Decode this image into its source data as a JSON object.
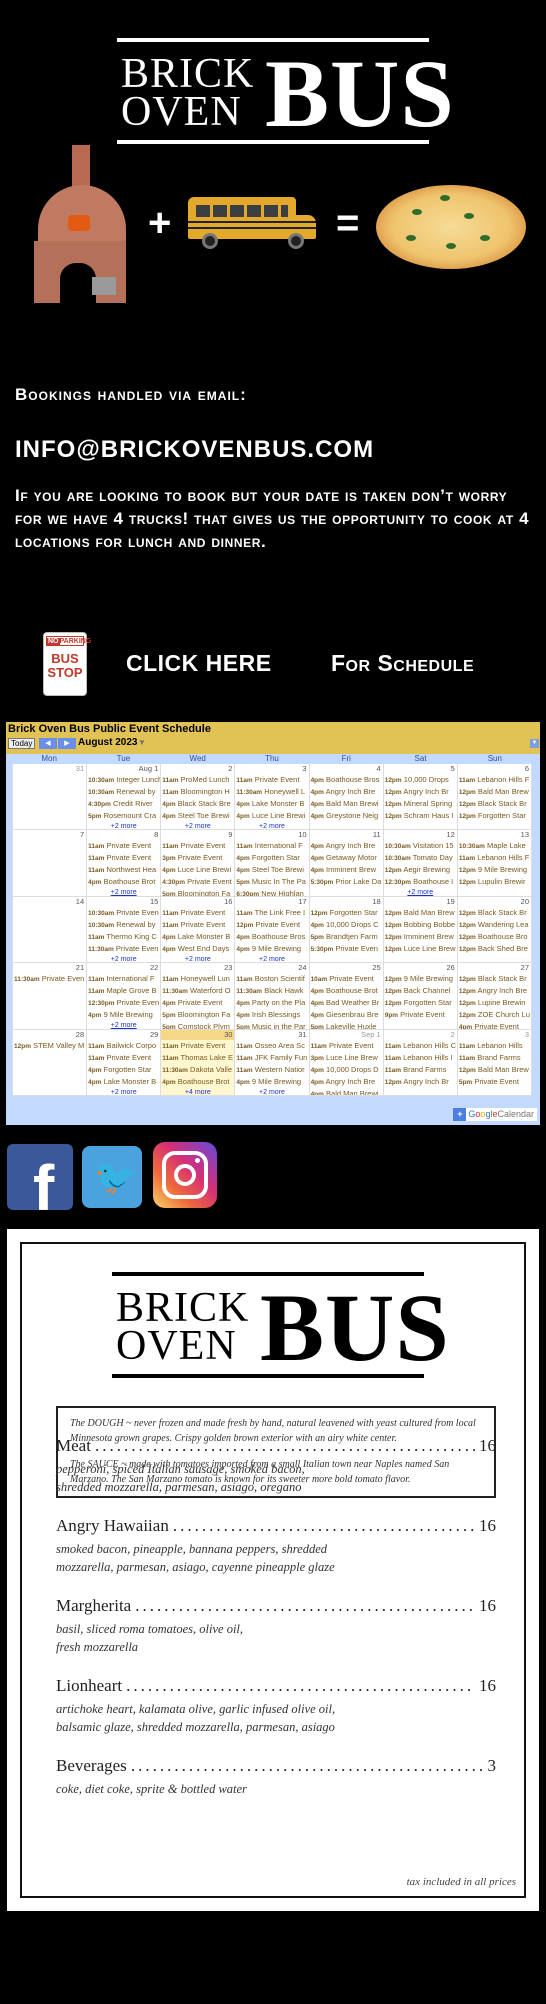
{
  "brand": {
    "logo_line1": "BRICK",
    "logo_line2": "OVEN",
    "logo_big": "BUS",
    "plus": "+",
    "equals": "="
  },
  "contact": {
    "bookings_heading": "Bookings handled via email:",
    "email": "INFO@BRICKOVENBUS.COM",
    "info_text": "If you are looking to book but your date is taken don’t worry for we have  4 trucks! that gives us the opportunity to cook at 4 locations for lunch and dinner."
  },
  "schedule_link": {
    "sign_top": "PARKING",
    "sign_no": "NO",
    "sign_line1": "BUS",
    "sign_line2": "STOP",
    "click_here": "CLICK HERE",
    "for_schedule": "For Schedule"
  },
  "calendar": {
    "title": "Brick Oven Bus Public Event Schedule",
    "today_label": "Today",
    "prev_icon": "◀",
    "next_icon": "▶",
    "month_label": "August 2023",
    "caret": "▼",
    "menu_icon": "▼",
    "days_of_week": [
      "Mon",
      "Tue",
      "Wed",
      "Thu",
      "Fri",
      "Sat",
      "Sun"
    ],
    "footer_plus": "+",
    "footer_google": [
      "G",
      "o",
      "o",
      "g",
      "l",
      "e"
    ],
    "footer_calendar": "Calendar",
    "weeks": [
      [
        {
          "date": "31",
          "other": true,
          "events": [],
          "more": ""
        },
        {
          "date": "Aug 1",
          "events": [
            [
              "10:30am",
              "Integer Lunch"
            ],
            [
              "10:30am",
              "Renewal by"
            ],
            [
              "4:30pm",
              "Credit River"
            ],
            [
              "5pm",
              "Rosemount Cra"
            ]
          ],
          "more": "+2 more"
        },
        {
          "date": "2",
          "events": [
            [
              "11am",
              "ProMed Lunch"
            ],
            [
              "11am",
              "Bloomington H"
            ],
            [
              "4pm",
              "Black Stack Bre"
            ],
            [
              "4pm",
              "Steel Toe Brewi"
            ]
          ],
          "more": "+2 more"
        },
        {
          "date": "3",
          "events": [
            [
              "11am",
              "Private Event"
            ],
            [
              "11:30am",
              "Honeywell L"
            ],
            [
              "4pm",
              "Lake Monster B"
            ],
            [
              "4pm",
              "Luce Line Brewi"
            ]
          ],
          "more": "+2 more"
        },
        {
          "date": "4",
          "events": [
            [
              "4pm",
              "Boathouse Bros"
            ],
            [
              "4pm",
              "Angry Inch Bre"
            ],
            [
              "4pm",
              "Bald Man Brewi"
            ],
            [
              "4pm",
              "Greystone Neig"
            ]
          ],
          "more": ""
        },
        {
          "date": "5",
          "events": [
            [
              "12pm",
              "10,000 Drops"
            ],
            [
              "12pm",
              "Angry Inch Br"
            ],
            [
              "12pm",
              "Mineral Spring"
            ],
            [
              "12pm",
              "Schram Haus I"
            ]
          ],
          "more": ""
        },
        {
          "date": "6",
          "events": [
            [
              "11am",
              "Lebanon Hills F"
            ],
            [
              "12pm",
              "Bald Man Brew"
            ],
            [
              "12pm",
              "Black Stack Br"
            ],
            [
              "12pm",
              "Forgotten Star"
            ]
          ],
          "more": ""
        }
      ],
      [
        {
          "date": "7",
          "events": [],
          "more": ""
        },
        {
          "date": "8",
          "events": [
            [
              "11am",
              "Private Event"
            ],
            [
              "11am",
              "Private Event"
            ],
            [
              "11am",
              "Northwest Hea"
            ],
            [
              "4pm",
              "Boathouse Brot"
            ]
          ],
          "more": "+2 more"
        },
        {
          "date": "9",
          "events": [
            [
              "11am",
              "Private Event"
            ],
            [
              "3pm",
              "Private Event"
            ],
            [
              "4pm",
              "Luce Line Brewi"
            ],
            [
              "4:30pm",
              "Private Event"
            ],
            [
              "5pm",
              "Bloomington Fa"
            ]
          ],
          "more": ""
        },
        {
          "date": "10",
          "events": [
            [
              "11am",
              "International F"
            ],
            [
              "4pm",
              "Forgotten Star"
            ],
            [
              "4pm",
              "Steel Toe Brewi"
            ],
            [
              "5pm",
              "Music In The Pa"
            ],
            [
              "6:30pm",
              "New Highlan"
            ]
          ],
          "more": ""
        },
        {
          "date": "11",
          "events": [
            [
              "4pm",
              "Angry Inch Bre"
            ],
            [
              "4pm",
              "Getaway Motor"
            ],
            [
              "4pm",
              "Imminent Brew"
            ],
            [
              "5:30pm",
              "Prior Lake Da"
            ]
          ],
          "more": ""
        },
        {
          "date": "12",
          "events": [
            [
              "10:30am",
              "Visitation 15"
            ],
            [
              "10:30am",
              "Tomato Day"
            ],
            [
              "12pm",
              "Aegir Brewing"
            ],
            [
              "12:30pm",
              "Boathouse I"
            ]
          ],
          "more": "+2 more"
        },
        {
          "date": "13",
          "events": [
            [
              "10:30am",
              "Maple Lake"
            ],
            [
              "11am",
              "Lebanon Hills F"
            ],
            [
              "12pm",
              "9 Mile Brewing"
            ],
            [
              "12pm",
              "Lupulin Brewir"
            ]
          ],
          "more": ""
        }
      ],
      [
        {
          "date": "14",
          "events": [],
          "more": ""
        },
        {
          "date": "15",
          "events": [
            [
              "10:30am",
              "Private Even"
            ],
            [
              "10:30am",
              "Renewal by"
            ],
            [
              "11am",
              "Thermo King C"
            ],
            [
              "11:30am",
              "Private Even"
            ]
          ],
          "more": "+2 more"
        },
        {
          "date": "16",
          "events": [
            [
              "11am",
              "Private Event"
            ],
            [
              "11am",
              "Private Event"
            ],
            [
              "4pm",
              "Lake Monster B"
            ],
            [
              "4pm",
              "West End Days"
            ]
          ],
          "more": "+2 more"
        },
        {
          "date": "17",
          "events": [
            [
              "11am",
              "The Link Free I"
            ],
            [
              "12pm",
              "Private Event"
            ],
            [
              "4pm",
              "Boathouse Bros"
            ],
            [
              "4pm",
              "9 Mile Brewing"
            ]
          ],
          "more": "+2 more"
        },
        {
          "date": "18",
          "events": [
            [
              "12pm",
              "Forgotten Star"
            ],
            [
              "4pm",
              "10,000 Drops C"
            ],
            [
              "5pm",
              "Brandtjen Farm"
            ],
            [
              "5:30pm",
              "Private Even"
            ]
          ],
          "more": ""
        },
        {
          "date": "19",
          "events": [
            [
              "12pm",
              "Bald Man Brew"
            ],
            [
              "12pm",
              "Bobbing Bobbe"
            ],
            [
              "12pm",
              "Imminent Brew"
            ],
            [
              "12pm",
              "Luce Line Brew"
            ]
          ],
          "more": ""
        },
        {
          "date": "20",
          "events": [
            [
              "12pm",
              "Black Stack Br"
            ],
            [
              "12pm",
              "Wandering Lea"
            ],
            [
              "12pm",
              "Boathouse Bro"
            ],
            [
              "12pm",
              "Back Shed Bre"
            ]
          ],
          "more": ""
        }
      ],
      [
        {
          "date": "21",
          "events": [
            [
              "11:30am",
              "Private Even"
            ]
          ],
          "more": ""
        },
        {
          "date": "22",
          "events": [
            [
              "11am",
              "International F"
            ],
            [
              "11am",
              "Maple Grove B"
            ],
            [
              "12:30pm",
              "Private Even"
            ],
            [
              "4pm",
              "9 Mile Brewing"
            ]
          ],
          "more": "+2 more"
        },
        {
          "date": "23",
          "events": [
            [
              "11am",
              "Honeywell Lun"
            ],
            [
              "11:30am",
              "Waterford O"
            ],
            [
              "4pm",
              "Private Event"
            ],
            [
              "5pm",
              "Bloomington Fa"
            ],
            [
              "5pm",
              "Comstock Plym"
            ]
          ],
          "more": ""
        },
        {
          "date": "24",
          "events": [
            [
              "11am",
              "Boston Scientif"
            ],
            [
              "11:30am",
              "Black Hawk"
            ],
            [
              "4pm",
              "Party on the Pla"
            ],
            [
              "4pm",
              "Irish Blessings"
            ],
            [
              "5pm",
              "Music in the Par"
            ]
          ],
          "more": ""
        },
        {
          "date": "25",
          "events": [
            [
              "10am",
              "Private Event"
            ],
            [
              "4pm",
              "Boathouse Brot"
            ],
            [
              "4pm",
              "Bad Weather Br"
            ],
            [
              "4pm",
              "Giesenbrau Bre"
            ],
            [
              "5pm",
              "Lakeville Huxle"
            ]
          ],
          "more": ""
        },
        {
          "date": "26",
          "events": [
            [
              "12pm",
              "9 Mile Brewing"
            ],
            [
              "12pm",
              "Back Channel"
            ],
            [
              "12pm",
              "Forgotten Star"
            ],
            [
              "9pm",
              "Private Event"
            ]
          ],
          "more": ""
        },
        {
          "date": "27",
          "events": [
            [
              "12pm",
              "Black Stack Br"
            ],
            [
              "12pm",
              "Angry Inch Bre"
            ],
            [
              "12pm",
              "Lupine Brewin"
            ],
            [
              "12pm",
              "ZOE Church Lu"
            ],
            [
              "4pm",
              "Private Event"
            ]
          ],
          "more": ""
        }
      ],
      [
        {
          "date": "28",
          "events": [
            [
              "12pm",
              "STEM Valley M"
            ]
          ],
          "more": ""
        },
        {
          "date": "29",
          "events": [
            [
              "11am",
              "Bailwick Corpo"
            ],
            [
              "11am",
              "Private Event"
            ],
            [
              "4pm",
              "Forgotten Star"
            ],
            [
              "4pm",
              "Lake Monster B"
            ]
          ],
          "more": "+2 more"
        },
        {
          "date": "30",
          "today": true,
          "events": [
            [
              "11am",
              "Private Event"
            ],
            [
              "11am",
              "Thomas Lake E"
            ],
            [
              "11:30am",
              "Dakota Valle"
            ],
            [
              "4pm",
              "Boathouse Brot"
            ]
          ],
          "more": "+4 more"
        },
        {
          "date": "31",
          "events": [
            [
              "11am",
              "Osseo Area Sc"
            ],
            [
              "11am",
              "JFK Family Fun"
            ],
            [
              "11am",
              "Western Natior"
            ],
            [
              "4pm",
              "9 Mile Brewing"
            ]
          ],
          "more": "+2 more"
        },
        {
          "date": "Sep 1",
          "other": true,
          "events": [
            [
              "11am",
              "Private Event"
            ],
            [
              "3pm",
              "Luce Line Brew"
            ],
            [
              "4pm",
              "10,000 Drops D"
            ],
            [
              "4pm",
              "Angry Inch Bre"
            ],
            [
              "4pm",
              "Bald Man Brewi"
            ]
          ],
          "more": ""
        },
        {
          "date": "2",
          "other": true,
          "events": [
            [
              "11am",
              "Lebanon Hills C"
            ],
            [
              "11am",
              "Lebanon Hills I"
            ],
            [
              "11am",
              "Brand Farms"
            ],
            [
              "12pm",
              "Angry Inch Br"
            ]
          ],
          "more": ""
        },
        {
          "date": "3",
          "other": true,
          "events": [
            [
              "11am",
              "Lebanon Hills"
            ],
            [
              "11am",
              "Brand Farms"
            ],
            [
              "12pm",
              "Bald Man Brew"
            ],
            [
              "5pm",
              "Private Event"
            ]
          ],
          "more": ""
        }
      ]
    ]
  },
  "social": {
    "facebook_glyph": "f",
    "twitter_glyph": "🐦"
  },
  "menu": {
    "logo_line1": "BRICK",
    "logo_line2": "OVEN",
    "logo_big": "BUS",
    "dough_text": "The DOUGH ~ never frozen and made fresh by hand, natural leavened with yeast cultured from local Minnesota grown grapes. Crispy golden brown exterior with an airy white center.",
    "sauce_text": "The SAUCE ~ made with tomatoes imported from a small Italian town near Naples named San Marzano. The San Marzano tomato is known for its sweeter more bold tomato flavor.",
    "items": [
      {
        "name": "Meat",
        "price": "16",
        "ingredients_1": "pepperoni, spiced Italian sausage, smoked bacon,",
        "ingredients_2": "shredded mozzarella, parmesan, asiago, oregano"
      },
      {
        "name": "Angry Hawaiian",
        "price": "16",
        "ingredients_1": "smoked bacon, pineapple, bannana peppers, shredded",
        "ingredients_2": "mozzarella, parmesan, asiago, cayenne pineapple glaze"
      },
      {
        "name": "Margherita",
        "price": "16",
        "ingredients_1": "basil, sliced roma tomatoes, olive oil,",
        "ingredients_2": "fresh mozzarella"
      },
      {
        "name": "Lionheart",
        "price": "16",
        "ingredients_1": "artichoke heart, kalamata olive, garlic infused olive oil,",
        "ingredients_2": "balsamic glaze, shredded mozzarella, parmesan, asiago"
      },
      {
        "name": "Beverages",
        "price": "3",
        "ingredients_1": "coke, diet coke, sprite & bottled water",
        "ingredients_2": ""
      }
    ],
    "tax_note": "tax included in all prices"
  }
}
